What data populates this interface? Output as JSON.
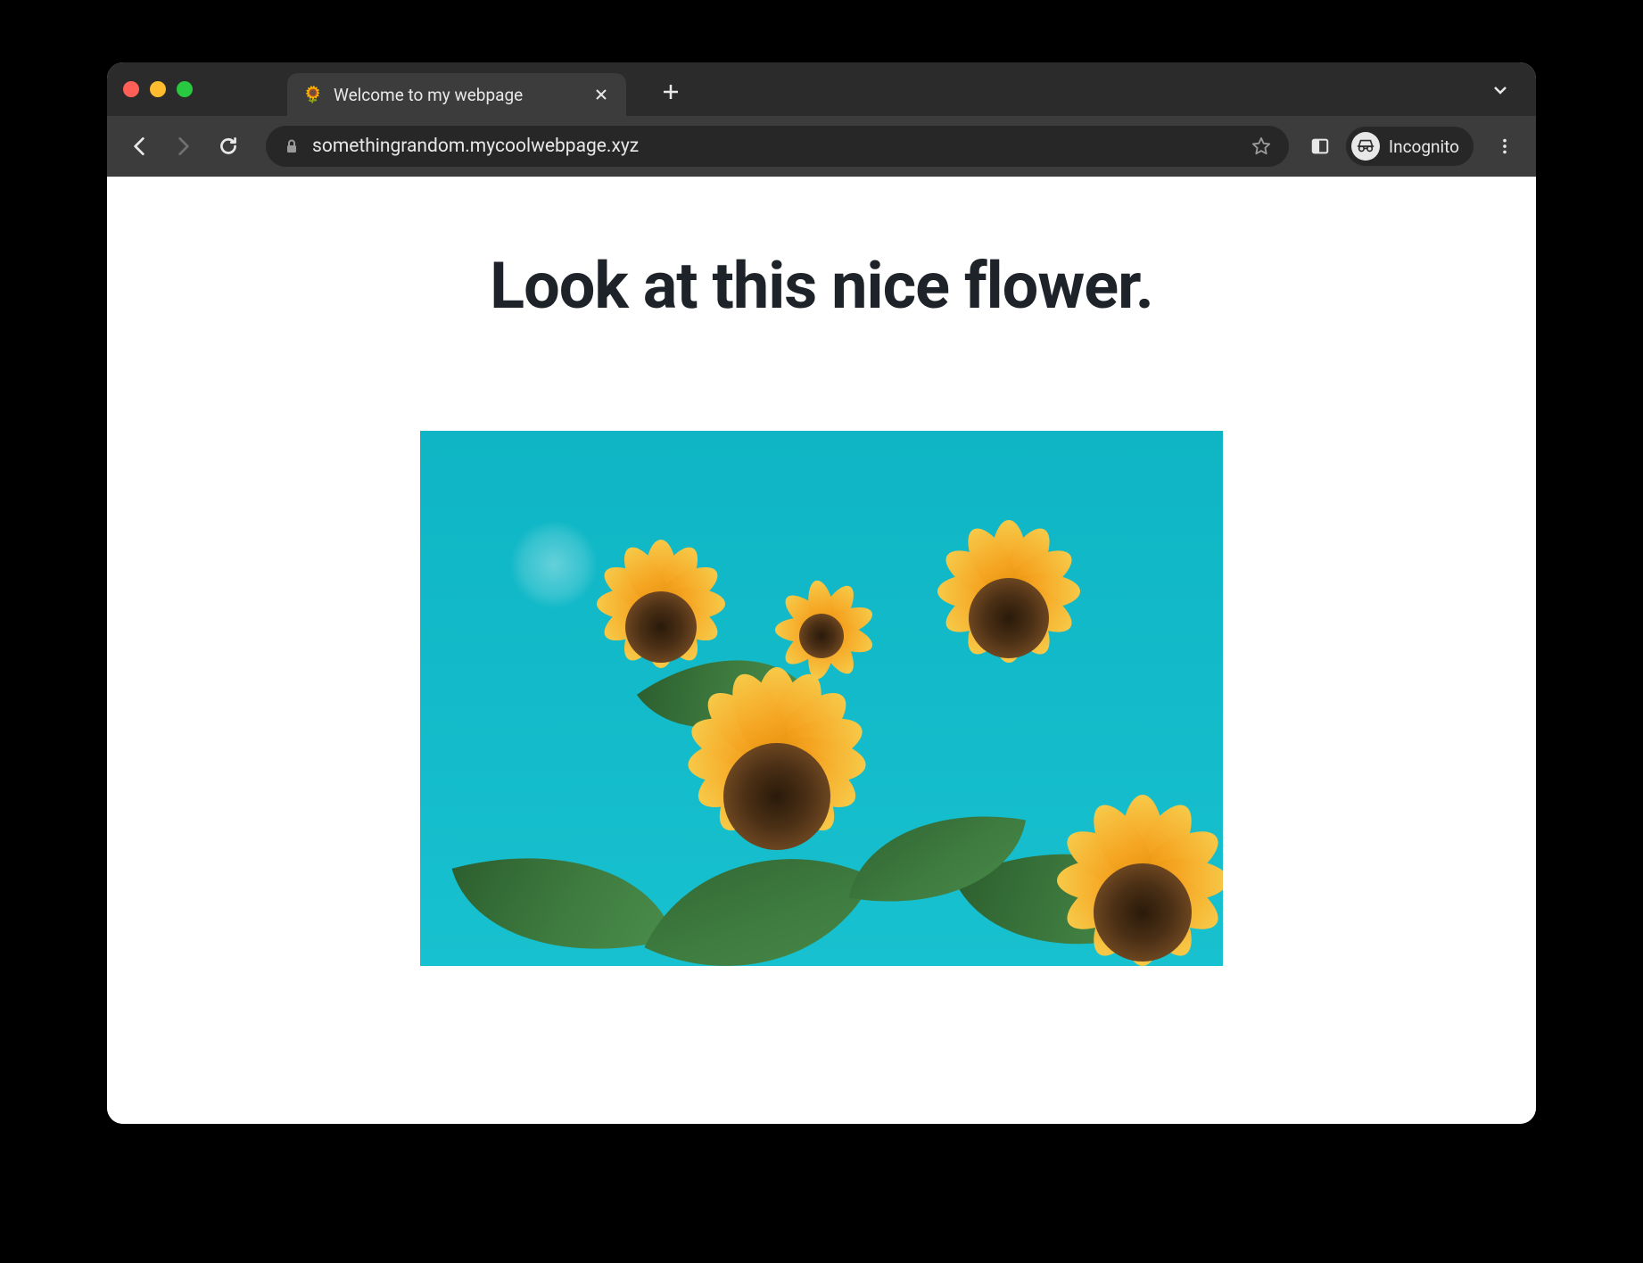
{
  "browser": {
    "tab_title": "Welcome to my webpage",
    "tab_favicon": "sunflower",
    "url": "somethingrandom.mycoolwebpage.xyz",
    "incognito_label": "Incognito"
  },
  "page": {
    "heading": "Look at this nice flower.",
    "image_description": "sunflowers against teal sky"
  }
}
